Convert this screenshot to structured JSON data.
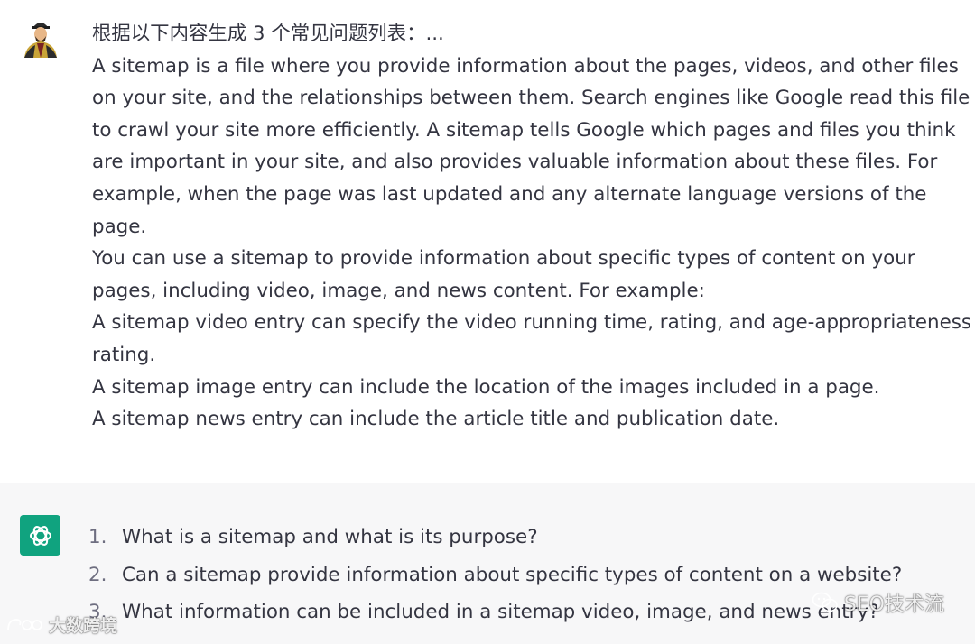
{
  "colors": {
    "assistant_avatar_bg": "#10a37f",
    "assistant_block_bg": "#f7f7f8",
    "text": "#343541"
  },
  "user_message": {
    "avatar_icon": "user-avatar-icon",
    "lines": [
      "根据以下内容生成 3 个常见问题列表：...",
      "A sitemap is a file where you provide information about the pages, videos, and other files",
      "on your site, and the relationships between them. Search engines like Google read this file",
      "to crawl your site more efficiently. A sitemap tells Google which pages and files you think",
      "are important in your site, and also provides valuable information about these files. For",
      "example, when the page was last updated and any alternate language versions of the",
      "page.",
      "You can use a sitemap to provide information about specific types of content on your",
      "pages, including video, image, and news content. For example:",
      "A sitemap video entry can specify the video running time, rating, and age-appropriateness",
      "rating.",
      "A sitemap image entry can include the location of the images included in a page.",
      "A sitemap news entry can include the article title and publication date."
    ]
  },
  "assistant_message": {
    "avatar_icon": "openai-logo-icon",
    "items": [
      {
        "num": "1.",
        "text": "What is a sitemap and what is its purpose?"
      },
      {
        "num": "2.",
        "text": "Can a sitemap provide information about specific types of content on a website?"
      },
      {
        "num": "3.",
        "text": "What information can be included in a sitemap video, image, and news entry?"
      }
    ]
  },
  "watermarks": {
    "right": "SEO技术流",
    "left": "大数跨境"
  }
}
